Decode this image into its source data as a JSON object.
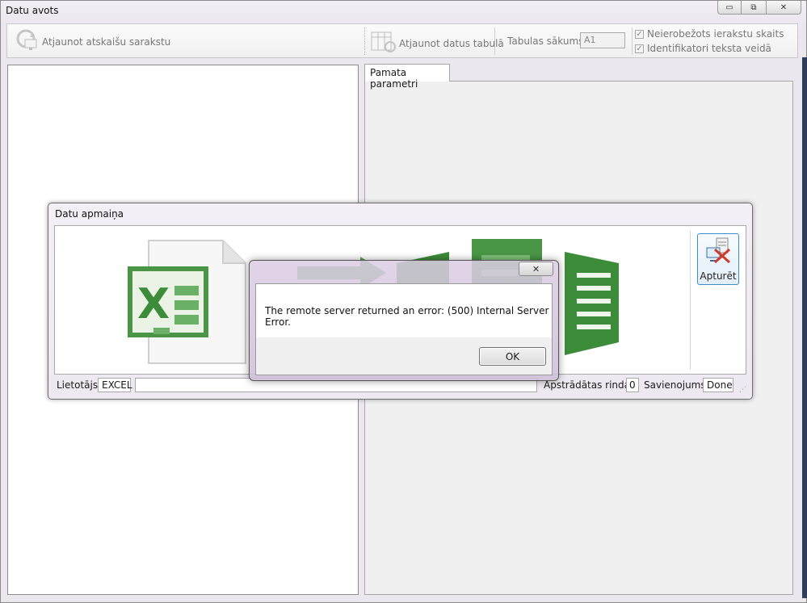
{
  "window": {
    "title": "Datu avots",
    "controls": {
      "minimize": "▭",
      "restore": "⧉",
      "close": "✕"
    }
  },
  "toolbar": {
    "refresh_reports_label": "Atjaunot atskaišu sarakstu",
    "refresh_table_label": "Atjaunot datus tabulā",
    "table_start_label": "Tabulas sākums:",
    "table_start_value": "A1",
    "unlimited_records_label": "Neierobežots ierakstu skaits",
    "id_as_text_label": "Identifikatori teksta veidā"
  },
  "tabs": [
    {
      "label": "Pamata parametri",
      "active": true
    }
  ],
  "exchange_dialog": {
    "title": "Datu apmaiņa",
    "stop_label": "Apturēt",
    "status": {
      "user_label": "Lietotājs:",
      "user_value": "EXCEL",
      "rows_label": "Apstrādātas rindas:",
      "rows_value": "0",
      "connection_label": "Savienojums:",
      "connection_value": "Done"
    }
  },
  "message_box": {
    "text": "The remote server returned an error: (500) Internal Server Error.",
    "ok_label": "OK",
    "close_glyph": "✕"
  },
  "colors": {
    "excel_green": "#3d8c3a",
    "excel_green_light": "#5aa657",
    "accent_blue": "#3b8ec9",
    "stop_red": "#d03a2a"
  },
  "icons": {
    "refresh_reports": "refresh-monitor-icon",
    "refresh_table": "refresh-table-icon",
    "excel": "excel-file-icon",
    "transfer": "transfer-arrow-icon",
    "database": "database-pages-icon",
    "stop": "stop-transfer-icon"
  }
}
